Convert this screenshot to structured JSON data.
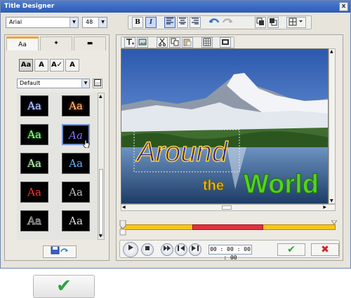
{
  "window": {
    "title": "Title Designer",
    "close_glyph": "x"
  },
  "toolbar": {
    "font": "Arial",
    "font_size": "48",
    "bold": "B",
    "italic": "I",
    "align_left_icon": "align-left-icon",
    "align_center_icon": "align-center-icon",
    "align_right_icon": "align-right-icon"
  },
  "left_panel": {
    "tabs": [
      {
        "label": "Aa",
        "active": true
      },
      {
        "label": "✦",
        "active": false
      },
      {
        "label": "▬",
        "active": false
      }
    ],
    "style_buttons": [
      "Aa",
      "A",
      "A✓",
      "A"
    ],
    "preset": "Default",
    "tiles": [
      {
        "text": "Aa",
        "color": "#c7d6ff"
      },
      {
        "text": "Aa",
        "color": "#ff9a3c"
      },
      {
        "text": "Aa",
        "color": "#77ff6f"
      },
      {
        "text": "Aa",
        "color": "#8a6dff"
      },
      {
        "text": "Aa",
        "color": "#d0f0c0"
      },
      {
        "text": "Aa",
        "color": "#3aa0ff"
      },
      {
        "text": "Aa",
        "color": "#ff3030"
      },
      {
        "text": "Aa",
        "color": "#bcbcbc"
      },
      {
        "text": "Aa",
        "color": "#999999"
      },
      {
        "text": "Aa",
        "color": "#dddddd"
      }
    ]
  },
  "canvas": {
    "title_text": "Around",
    "subtitle_small": "the",
    "subtitle_big": "World"
  },
  "player": {
    "timecode": "00 : 00 : 00 : 00",
    "ok": "✔",
    "cancel": "✖"
  },
  "footer": {
    "ok": "✔"
  }
}
